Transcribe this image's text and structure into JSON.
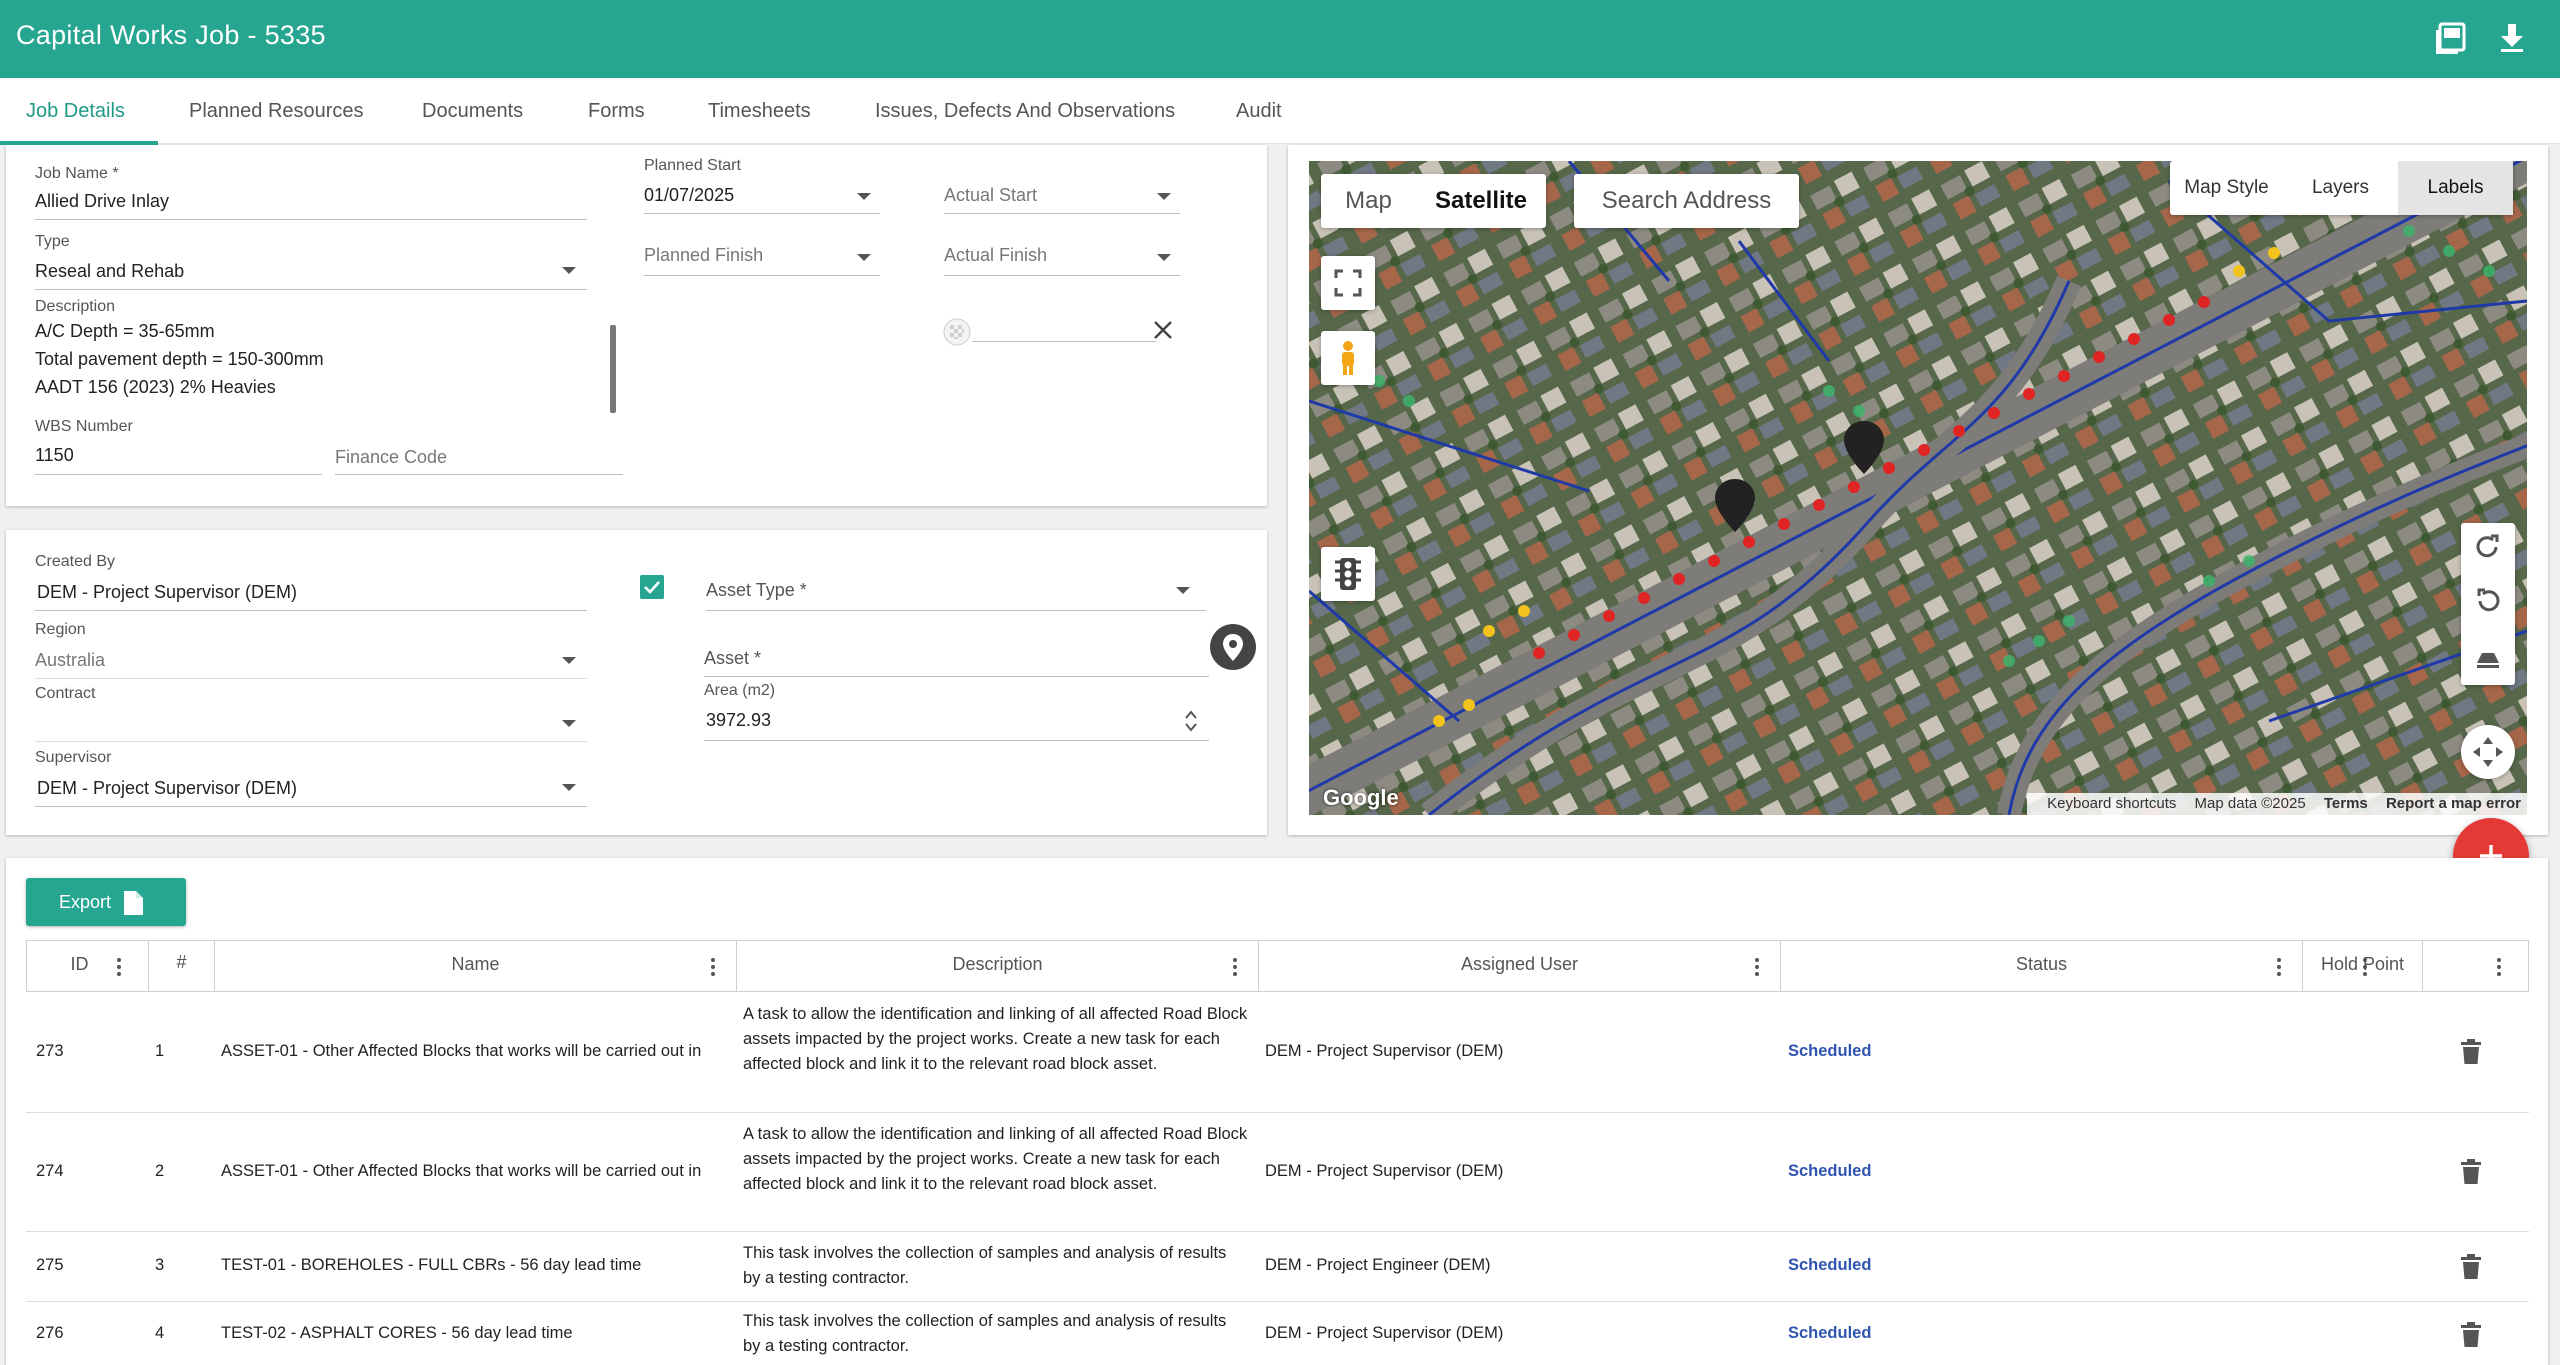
{
  "header": {
    "title": "Capital Works Job - 5335",
    "pdf_icon": "pdf-icon",
    "download_icon": "download-icon"
  },
  "tabs": [
    {
      "label": "Job Details",
      "active": true
    },
    {
      "label": "Planned Resources"
    },
    {
      "label": "Documents"
    },
    {
      "label": "Forms"
    },
    {
      "label": "Timesheets"
    },
    {
      "label": "Issues, Defects And Observations"
    },
    {
      "label": "Audit"
    }
  ],
  "job": {
    "job_name_label": "Job Name *",
    "job_name": "Allied Drive Inlay",
    "type_label": "Type",
    "type": "Reseal and Rehab",
    "description_label": "Description",
    "description_lines": [
      "A/C Depth = 35-65mm",
      "Total pavement depth = 150-300mm",
      "AADT 156 (2023) 2% Heavies"
    ],
    "wbs_label": "WBS Number",
    "wbs": "1150",
    "finance_code_label": "Finance Code",
    "planned_start_label": "Planned Start",
    "planned_start": "01/07/2025",
    "actual_start_label": "Actual Start",
    "planned_finish_label": "Planned Finish",
    "actual_finish_label": "Actual Finish"
  },
  "details": {
    "created_by_label": "Created By",
    "created_by": "DEM - Project Supervisor (DEM)",
    "region_label": "Region",
    "region": "Australia",
    "contract_label": "Contract",
    "supervisor_label": "Supervisor",
    "supervisor": "DEM - Project Supervisor (DEM)",
    "asset_type_label": "Asset Type *",
    "asset_label": "Asset *",
    "area_label": "Area (m2)",
    "area": "3972.93",
    "checkbox_checked": true
  },
  "map": {
    "tab_map": "Map",
    "tab_satellite": "Satellite",
    "search_label": "Search Address",
    "map_style": "Map Style",
    "layers": "Layers",
    "labels": "Labels",
    "logo": "Google",
    "footer_shortcuts": "Keyboard shortcuts",
    "footer_data": "Map data ©2025",
    "footer_terms": "Terms",
    "footer_report": "Report a map error"
  },
  "table": {
    "export_label": "Export",
    "columns": [
      "ID",
      "#",
      "Name",
      "Description",
      "Assigned User",
      "Status",
      "Hold Point"
    ],
    "rows": [
      {
        "id": "273",
        "num": "1",
        "name": "ASSET-01 - Other Affected Blocks that works will be carried out in",
        "description": "A task to allow the identification and linking of all affected Road Block assets impacted by the project works. Create a new task for each affected block and link it to the relevant road block asset.",
        "user": "DEM - Project Supervisor (DEM)",
        "status": "Scheduled"
      },
      {
        "id": "274",
        "num": "2",
        "name": "ASSET-01 - Other Affected Blocks that works will be carried out in",
        "description": "A task to allow the identification and linking of all affected Road Block assets impacted by the project works. Create a new task for each affected block and link it to the relevant road block asset.",
        "user": "DEM - Project Supervisor (DEM)",
        "status": "Scheduled"
      },
      {
        "id": "275",
        "num": "3",
        "name": "TEST-01 - BOREHOLES - FULL CBRs - 56 day lead time",
        "description": "This task involves the collection of samples and analysis of results by a testing contractor.",
        "user": "DEM - Project Engineer (DEM)",
        "status": "Scheduled"
      },
      {
        "id": "276",
        "num": "4",
        "name": "TEST-02 - ASPHALT CORES - 56 day lead time",
        "description": "This task involves the collection of samples and analysis of results by a testing contractor.",
        "user": "DEM - Project Supervisor (DEM)",
        "status": "Scheduled"
      }
    ]
  },
  "colors": {
    "primary": "#26a591",
    "status": "#2f55b0",
    "fab": "#e53935"
  }
}
